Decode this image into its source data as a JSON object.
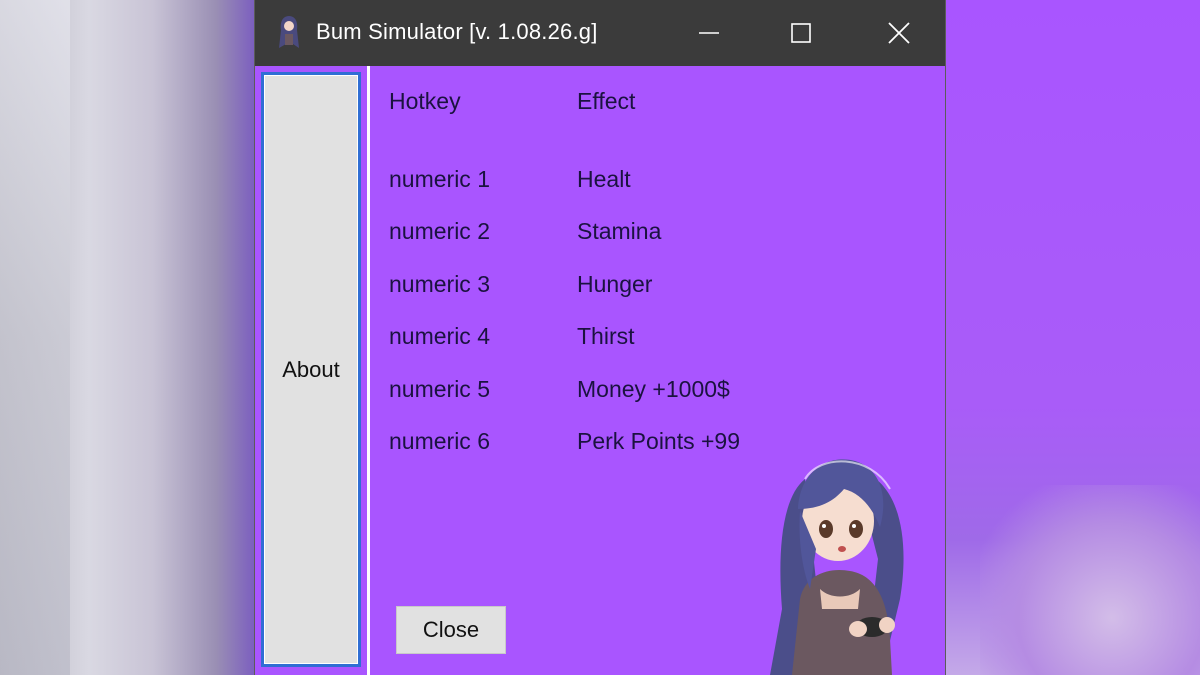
{
  "window": {
    "title": "Bum Simulator [v. 1.08.26.g]",
    "icons": {
      "app": "anime-character-icon",
      "minimize": "minimize-icon",
      "maximize": "maximize-icon",
      "close": "close-icon"
    }
  },
  "sidebar": {
    "about_label": "About"
  },
  "table": {
    "headers": [
      "Hotkey",
      "Effect"
    ],
    "rows": [
      {
        "hotkey": "numeric 1",
        "effect": "Healt"
      },
      {
        "hotkey": "numeric 2",
        "effect": "Stamina"
      },
      {
        "hotkey": "numeric 3",
        "effect": "Hunger"
      },
      {
        "hotkey": "numeric 4",
        "effect": "Thirst"
      },
      {
        "hotkey": "numeric 5",
        "effect": "Money +1000$"
      },
      {
        "hotkey": "numeric 6",
        "effect": "Perk Points +99"
      }
    ]
  },
  "footer": {
    "close_label": "Close"
  },
  "colors": {
    "accent": "#a955ff",
    "titlebar": "#3b3b3b",
    "focus_border": "#2f6ed4",
    "text": "#1b1240"
  }
}
